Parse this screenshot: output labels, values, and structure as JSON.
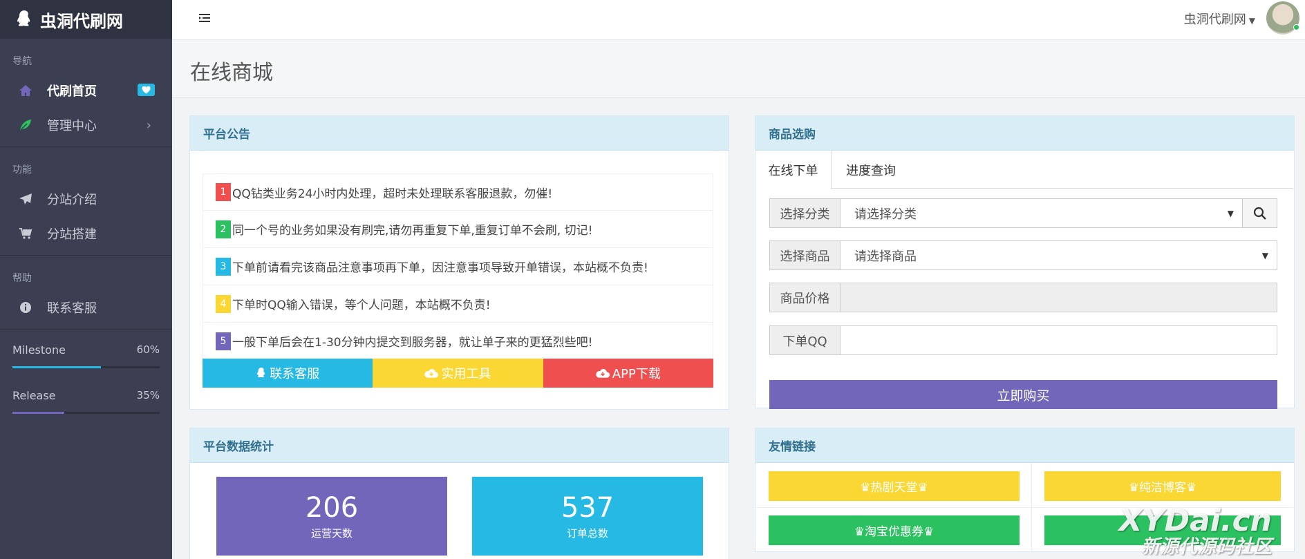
{
  "sidebar": {
    "brand": "虫洞代刷网",
    "sections": [
      {
        "heading": "导航"
      },
      {
        "heading": "功能"
      },
      {
        "heading": "帮助"
      }
    ],
    "items": [
      {
        "label": "代刷首页"
      },
      {
        "label": "管理中心"
      },
      {
        "label": "分站介绍"
      },
      {
        "label": "分站搭建"
      },
      {
        "label": "联系客服"
      }
    ],
    "progress": [
      {
        "label": "Milestone",
        "percent_text": "60%",
        "value": 60,
        "color": "#25b9e4"
      },
      {
        "label": "Release",
        "percent_text": "35%",
        "value": 35,
        "color": "#7266ba"
      }
    ]
  },
  "topbar": {
    "user_name": "虫洞代刷网"
  },
  "page": {
    "title": "在线商城"
  },
  "notice_panel": {
    "title": "平台公告",
    "items": [
      {
        "num": "1",
        "text": "QQ钻类业务24小时内处理，超时未处理联系客服退款，勿催!",
        "color": "#ef4f4f"
      },
      {
        "num": "2",
        "text": "同一个号的业务如果没有刷完,请勿再重复下单,重复订单不会刷, 切记!",
        "color": "#2bc160"
      },
      {
        "num": "3",
        "text": "下单前请看完该商品注意事项再下单，因注意事项导致开单错误，本站概不负责!",
        "color": "#25b9e4"
      },
      {
        "num": "4",
        "text": "下单时QQ输入错误，等个人问题，本站概不负责!",
        "color": "#fad733"
      },
      {
        "num": "5",
        "text": "一般下单后会在1-30分钟内提交到服务器，就让单子来的更猛烈些吧!",
        "color": "#7266ba"
      }
    ],
    "buttons": [
      {
        "label": "联系客服",
        "color": "#25b9e4"
      },
      {
        "label": "实用工具",
        "color": "#fad733"
      },
      {
        "label": "APP下载",
        "color": "#ef4f4f"
      }
    ]
  },
  "shop_panel": {
    "title": "商品选购",
    "tabs": [
      "在线下单",
      "进度查询"
    ],
    "category_label": "选择分类",
    "category_value": "请选择分类",
    "product_label": "选择商品",
    "product_value": "请选择商品",
    "price_label": "商品价格",
    "price_value": "",
    "qq_label": "下单QQ",
    "qq_value": "",
    "buy_label": "立即购买",
    "buy_color": "#7266ba"
  },
  "stats_panel": {
    "title": "平台数据统计",
    "stats": [
      {
        "value": "206",
        "label": "运营天数",
        "color": "#7266ba"
      },
      {
        "value": "537",
        "label": "订单总数",
        "color": "#25b9e4"
      }
    ]
  },
  "links_panel": {
    "title": "友情链接",
    "links": [
      {
        "label": "♛热剧天堂♛",
        "color": "#fad733"
      },
      {
        "label": "♛纯洁博客♛",
        "color": "#fad733"
      },
      {
        "label": "♛淘宝优惠券♛",
        "color": "#2bc160"
      },
      {
        "label": "",
        "color": "#2bc160"
      }
    ]
  },
  "watermark": {
    "line1": "XYDai.cn",
    "line2": "新源代源码社区"
  }
}
